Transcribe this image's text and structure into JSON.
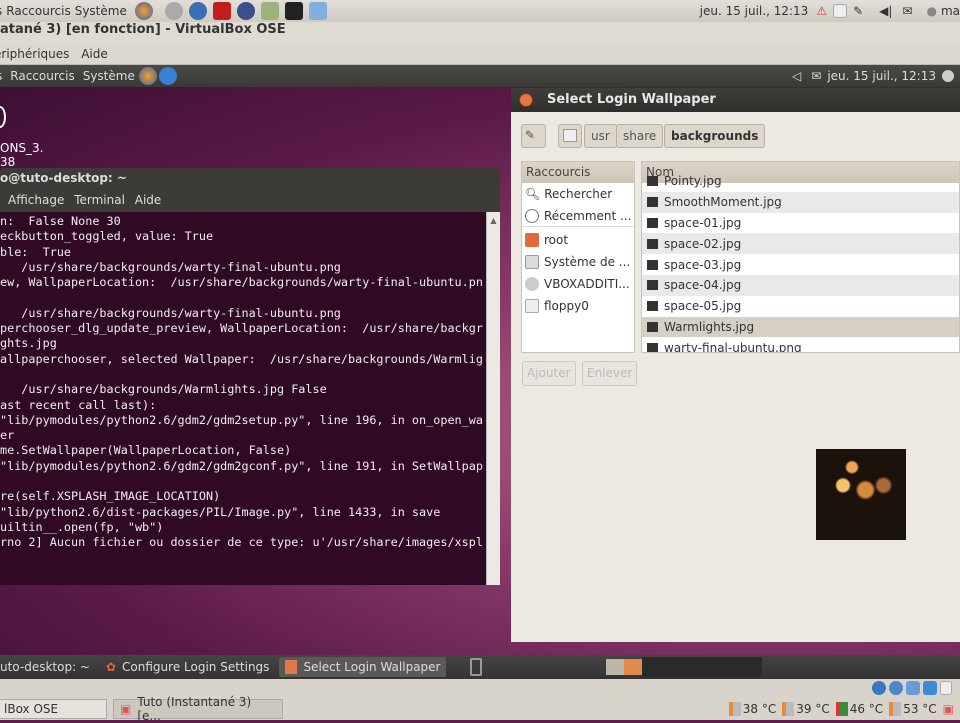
{
  "host_panel": {
    "menus": [
      "s",
      "Raccourcis",
      "Système"
    ],
    "clock": "jeu. 15 juil., 12:13",
    "user": "ma"
  },
  "vbox": {
    "title": "atané 3) [en fonction] - VirtualBox OSE",
    "menu": [
      "ériphériques",
      "Aide"
    ]
  },
  "guest_panel": {
    "menus": [
      "s",
      "Raccourcis",
      "Système"
    ],
    "clock": "jeu. 15 juil., 12:13"
  },
  "desktop": {
    "lines": [
      "ONS_3.",
      "38"
    ]
  },
  "terminal": {
    "title": "o@tuto-desktop: ~",
    "menu": [
      "Affichage",
      "Terminal",
      "Aide"
    ],
    "lines": [
      "n:  False None 30",
      "eckbutton_toggled, value: True",
      "ble:  True",
      "   /usr/share/backgrounds/warty-final-ubuntu.png",
      "ew, WallpaperLocation:  /usr/share/backgrounds/warty-final-ubuntu.pn",
      "",
      "   /usr/share/backgrounds/warty-final-ubuntu.png",
      "perchooser_dlg_update_preview, WallpaperLocation:  /usr/share/backgr",
      "ghts.jpg",
      "allpaperchooser, selected Wallpaper:  /usr/share/backgrounds/Warmlig",
      "",
      "   /usr/share/backgrounds/Warmlights.jpg False",
      "ast recent call last):",
      "\"lib/pymodules/python2.6/gdm2/gdm2setup.py\", line 196, in on_open_wa",
      "er",
      "me.SetWallpaper(WallpaperLocation, False)",
      "\"lib/pymodules/python2.6/gdm2/gdm2gconf.py\", line 191, in SetWallpap",
      "",
      "re(self.XSPLASH_IMAGE_LOCATION)",
      "\"lib/python2.6/dist-packages/PIL/Image.py\", line 1433, in save",
      "uiltin__.open(fp, \"wb\")",
      "rno 2] Aucun fichier ou dossier de ce type: u'/usr/share/images/xspl"
    ]
  },
  "dialog": {
    "title": "Select Login Wallpaper",
    "path": [
      "usr",
      "share",
      "backgrounds"
    ],
    "shortcuts_header": "Raccourcis",
    "shortcuts": [
      "Rechercher",
      "Récemment ...",
      "root",
      "Système de ...",
      "VBOXADDITI...",
      "floppy0"
    ],
    "files_header": "Nom",
    "files": [
      "Pointy.jpg",
      "SmoothMoment.jpg",
      "space-01.jpg",
      "space-02.jpg",
      "space-03.jpg",
      "space-04.jpg",
      "space-05.jpg",
      "Warmlights.jpg",
      "warty-final-ubuntu.png"
    ],
    "selected_file": "Warmlights.jpg",
    "add_label": "Ajouter",
    "remove_label": "Enlever"
  },
  "guest_taskbar": [
    "uto-desktop: ~",
    "Configure Login Settings",
    "Select Login Wallpaper"
  ],
  "host_taskbar": [
    "lBox OSE",
    "Tuto (Instantané 3) [e..."
  ],
  "temps": [
    "38 °C",
    "39 °C",
    "46 °C",
    "53 °C"
  ]
}
